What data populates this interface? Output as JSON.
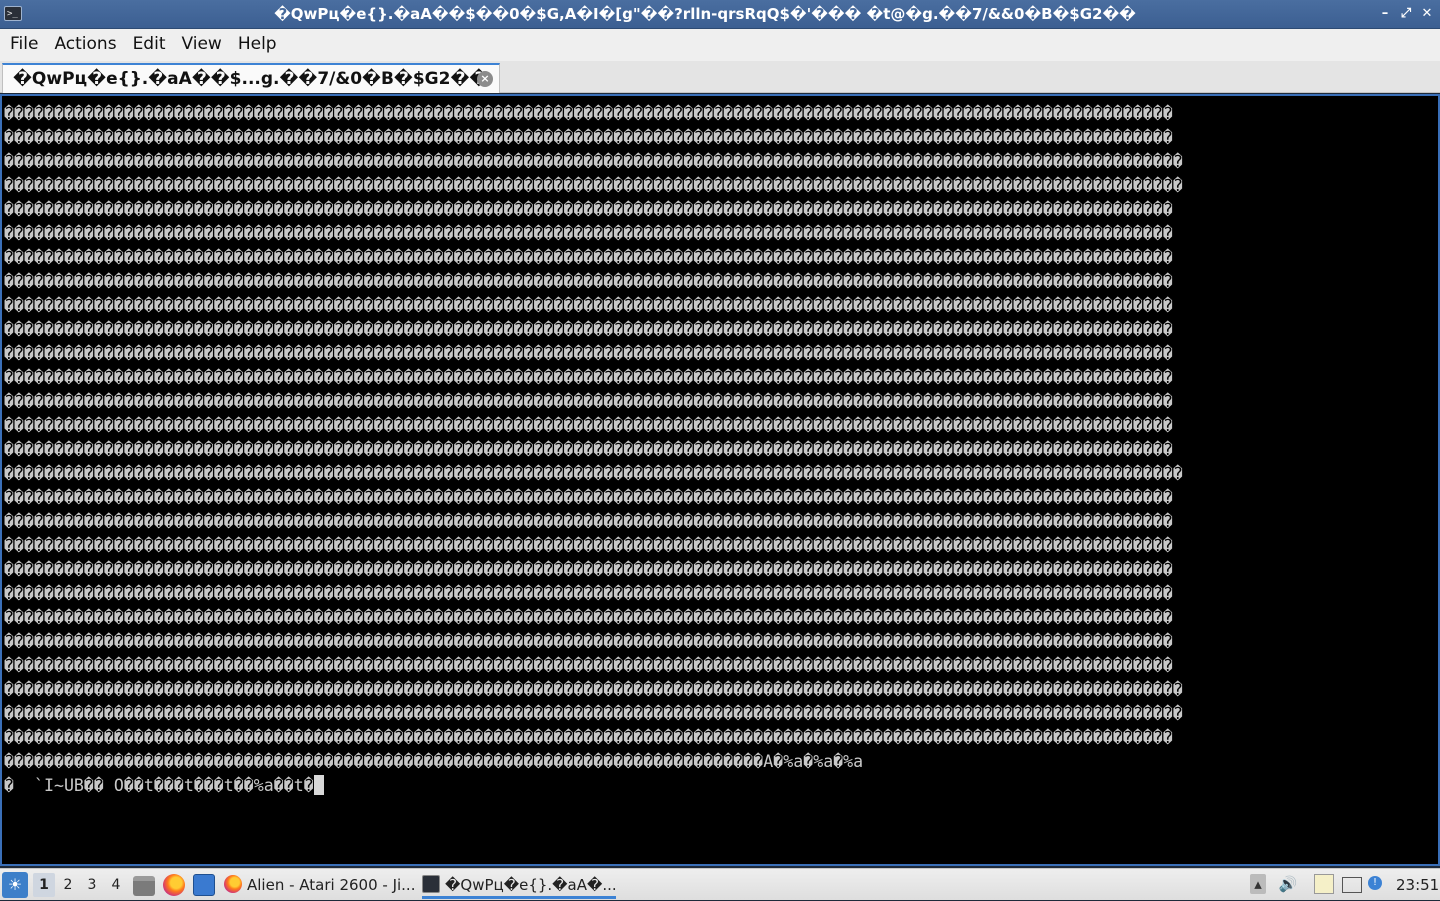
{
  "window": {
    "title": "�QwPц�e{}.�aA��$��0�$G,A�I�[g\"��?rlln-qrsRqQ$�'��� �t@�g.��7/&&0�B�$G2��",
    "minimize": "–",
    "maximize": "⤢",
    "close": "✕"
  },
  "menu": {
    "file": "File",
    "actions": "Actions",
    "edit": "Edit",
    "view": "View",
    "help": "Help"
  },
  "tab": {
    "label": "�QwPц�e{}.�aA��$...g.��7/&0�B�$G2��",
    "close": "×"
  },
  "terminal": {
    "lines": [
      "���������������������������������������������������������������������������������������������������������������������",
      "���������������������������������������������������������������������������������������������������������������������",
      "����������������������������������������������������������������������������������������������������������������������",
      "����������������������������������������������������������������������������������������������������������������������",
      "���������������������������������������������������������������������������������������������������������������������",
      "���������������������������������������������������������������������������������������������������������������������",
      "���������������������������������������������������������������������������������������������������������������������",
      "���������������������������������������������������������������������������������������������������������������������",
      "���������������������������������������������������������������������������������������������������������������������",
      "���������������������������������������������������������������������������������������������������������������������",
      "���������������������������������������������������������������������������������������������������������������������",
      "���������������������������������������������������������������������������������������������������������������������",
      "���������������������������������������������������������������������������������������������������������������������",
      "���������������������������������������������������������������������������������������������������������������������",
      "���������������������������������������������������������������������������������������������������������������������",
      "����������������������������������������������������������������������������������������������������������������������",
      "���������������������������������������������������������������������������������������������������������������������",
      "���������������������������������������������������������������������������������������������������������������������",
      "���������������������������������������������������������������������������������������������������������������������",
      "���������������������������������������������������������������������������������������������������������������������",
      "���������������������������������������������������������������������������������������������������������������������",
      "���������������������������������������������������������������������������������������������������������������������",
      "���������������������������������������������������������������������������������������������������������������������",
      "���������������������������������������������������������������������������������������������������������������������",
      "����������������������������������������������������������������������������������������������������������������������",
      "����������������������������������������������������������������������������������������������������������������������",
      "���������������������������������������������������������������������������������������������������������������������",
      "����������������������������������������������������������������������������A�%a�%a�%a"
    ],
    "prompt_line": "�  `I~UB�� O��t���t���t��%a��t�"
  },
  "taskbar": {
    "menu_icon": "start-menu-icon",
    "desktops": [
      "1",
      "2",
      "3",
      "4"
    ],
    "tasks": [
      {
        "label": "Alien - Atari 2600 - Ji..."
      },
      {
        "label": "�QwPц�e{}.�aA�..."
      }
    ],
    "clock": "23:51"
  },
  "colors": {
    "accent": "#3c82d4",
    "terminal_bg": "#000000",
    "terminal_fg": "#c8c8c8"
  }
}
